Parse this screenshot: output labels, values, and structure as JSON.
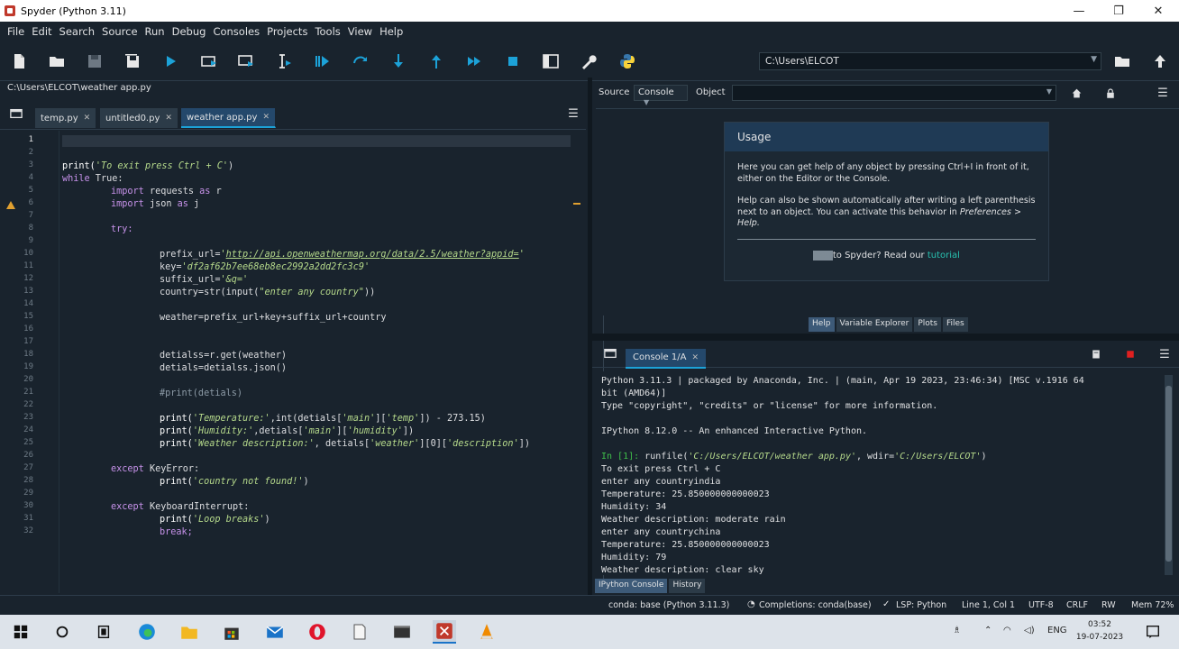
{
  "window": {
    "title": "Spyder (Python 3.11)"
  },
  "menu": [
    "File",
    "Edit",
    "Search",
    "Source",
    "Run",
    "Debug",
    "Consoles",
    "Projects",
    "Tools",
    "View",
    "Help"
  ],
  "toolbar": {
    "path": "C:\\Users\\ELCOT"
  },
  "editor": {
    "file_path": "C:\\Users\\ELCOT\\weather app.py",
    "tabs": [
      {
        "label": "temp.py"
      },
      {
        "label": "untitled0.py"
      },
      {
        "label": "weather app.py"
      }
    ],
    "line_numbers": [
      "1",
      "2",
      "3",
      "4",
      "5",
      "6",
      "7",
      "8",
      "9",
      "10",
      "11",
      "12",
      "13",
      "14",
      "15",
      "16",
      "17",
      "18",
      "19",
      "20",
      "21",
      "22",
      "23",
      "24",
      "25",
      "26",
      "27",
      "28",
      "29",
      "30",
      "31",
      "32"
    ],
    "code": {
      "l3a": "print(",
      "l3b": "'To exit press Ctrl + C'",
      "l3c": ")",
      "l4a": "while",
      "l4b": " True:",
      "l5a": "import",
      "l5b": " requests ",
      "l5c": "as",
      "l5d": " r",
      "l6a": "import",
      "l6b": " json ",
      "l6c": "as",
      "l6d": " j",
      "l8": "try:",
      "l10a": "prefix_url=",
      "l10b": "'",
      "l10c": "http://api.openweathermap.org/data/2.5/weather?appid=",
      "l10d": "'",
      "l11a": "key=",
      "l11b": "'df2af62b7ee68eb8ec2992a2dd2fc3c9'",
      "l12a": "suffix_url=",
      "l12b": "'&q='",
      "l13a": "country=str(input(",
      "l13b": "\"enter any country\"",
      "l13c": "))",
      "l15": "weather=prefix_url+key+suffix_url+country",
      "l18": "detialss=r.get(weather)",
      "l19": "detials=detialss.json()",
      "l21": "#print(detials)",
      "l23a": "print(",
      "l23b": "'Temperature:'",
      "l23c": ",int(detials[",
      "l23d": "'main'",
      "l23e": "][",
      "l23f": "'temp'",
      "l23g": "]) - 273.15)",
      "l24a": "print(",
      "l24b": "'Humidity:'",
      "l24c": ",detials[",
      "l24d": "'main'",
      "l24e": "][",
      "l24f": "'humidity'",
      "l24g": "])",
      "l25a": "print(",
      "l25b": "'Weather description:'",
      "l25c": ", detials[",
      "l25d": "'weather'",
      "l25e": "][0][",
      "l25f": "'description'",
      "l25g": "])",
      "l27a": "except",
      "l27b": " KeyError:",
      "l28a": "print(",
      "l28b": "'country not found!'",
      "l28c": ")",
      "l30a": "except",
      "l30b": " KeyboardInterrupt:",
      "l31a": "print(",
      "l31b": "'Loop breaks'",
      "l31c": ")",
      "l32": "break;"
    }
  },
  "help": {
    "source_label": "Source",
    "source_value": "Console",
    "object_label": "Object",
    "usage_title": "Usage",
    "p1": "Here you can get help of any object by pressing Ctrl+I in front of it, either on the Editor or the Console.",
    "p2a": "Help can also be shown automatically after writing a left parenthesis next to an object. You can activate this behavior in ",
    "p2b": "Preferences > Help.",
    "foot_hidden": "New",
    "foot_text": "to Spyder? Read our ",
    "foot_link": "tutorial",
    "tabs": [
      "Help",
      "Variable Explorer",
      "Plots",
      "Files"
    ]
  },
  "console": {
    "tab": "Console 1/A",
    "lines": {
      "c1": "Python 3.11.3 | packaged by Anaconda, Inc. | (main, Apr 19 2023, 23:46:34) [MSC v.1916 64",
      "c2": "bit (AMD64)]",
      "c3": "Type \"copyright\", \"credits\" or \"license\" for more information.",
      "c5": "IPython 8.12.0 -- An enhanced Interactive Python.",
      "c7a": "In [1]:",
      "c7b": " runfile(",
      "c7c": "'C:/Users/ELCOT/weather app.py'",
      "c7d": ", wdir=",
      "c7e": "'C:/Users/ELCOT'",
      "c7f": ")",
      "c8": "To exit press Ctrl + C",
      "c9": "enter any countryindia",
      "c10": "Temperature: 25.850000000000023",
      "c11": "Humidity: 34",
      "c12": "Weather description: moderate rain",
      "c13": "enter any countrychina",
      "c14": "Temperature: 25.850000000000023",
      "c15": "Humidity: 79",
      "c16": "Weather description: clear sky"
    },
    "bottom_tabs": [
      "IPython Console",
      "History"
    ]
  },
  "status": {
    "conda": "conda: base (Python 3.11.3)",
    "completions": "Completions: conda(base)",
    "lsp": "LSP: Python",
    "pos": "Line 1, Col 1",
    "enc": "UTF-8",
    "eol": "CRLF",
    "rw": "RW",
    "mem": "Mem 72%"
  },
  "taskbar": {
    "lang": "ENG",
    "time": "03:52",
    "date": "19-07-2023"
  }
}
